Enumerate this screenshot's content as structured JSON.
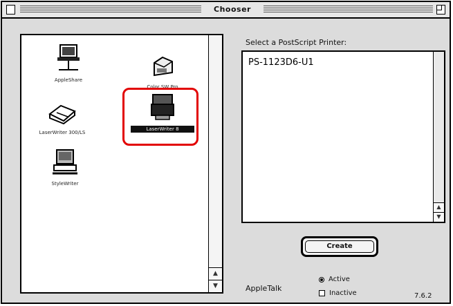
{
  "window": {
    "title": "Chooser"
  },
  "devices": [
    {
      "label": "AppleShare",
      "icon": "appleshare-icon"
    },
    {
      "label": "Color SW Pro",
      "icon": "color-printer-icon"
    },
    {
      "label": "LaserWriter 300/LS",
      "icon": "laserwriter-icon"
    },
    {
      "label": "LaserWriter 8",
      "icon": "laserwriter8-icon",
      "selected": true
    },
    {
      "label": "StyleWriter",
      "icon": "stylewriter-icon"
    }
  ],
  "printer_list": {
    "prompt": "Select a PostScript Printer:",
    "items": [
      "PS-1123D6-U1"
    ]
  },
  "create_button": {
    "label": "Create"
  },
  "appletalk": {
    "label": "AppleTalk",
    "options": [
      {
        "label": "Active",
        "selected": true
      },
      {
        "label": "Inactive",
        "selected": false
      }
    ]
  },
  "version": "7.6.2",
  "colors": {
    "highlight": "#e20000"
  }
}
